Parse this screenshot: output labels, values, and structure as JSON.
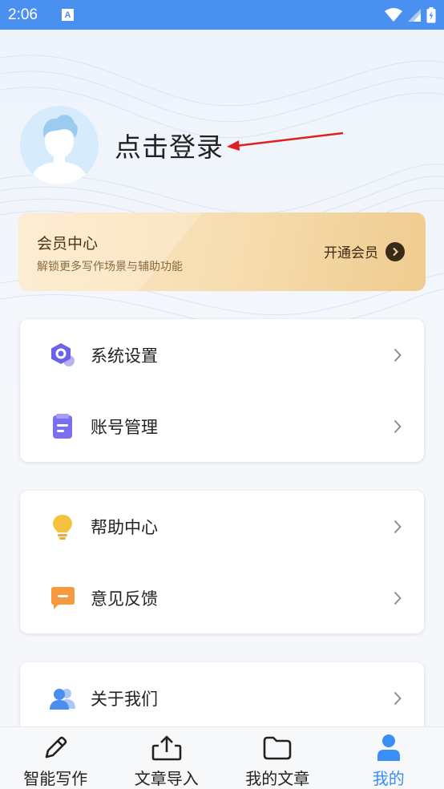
{
  "status_bar": {
    "time": "2:06",
    "notification_letter": "A"
  },
  "profile": {
    "login_label": "点击登录"
  },
  "vip": {
    "title": "会员中心",
    "subtitle": "解锁更多写作场景与辅助功能",
    "action_label": "开通会员"
  },
  "settings_group": {
    "items": [
      {
        "label": "系统设置",
        "icon": "settings-hexagon-icon"
      },
      {
        "label": "账号管理",
        "icon": "account-clipboard-icon"
      }
    ]
  },
  "help_group": {
    "items": [
      {
        "label": "帮助中心",
        "icon": "lightbulb-icon"
      },
      {
        "label": "意见反馈",
        "icon": "feedback-chat-icon"
      }
    ]
  },
  "about_group": {
    "items": [
      {
        "label": "关于我们",
        "icon": "users-icon"
      }
    ]
  },
  "tabbar": {
    "tabs": [
      {
        "label": "智能写作",
        "icon": "pencil-icon",
        "active": false
      },
      {
        "label": "文章导入",
        "icon": "upload-icon",
        "active": false
      },
      {
        "label": "我的文章",
        "icon": "folder-icon",
        "active": false
      },
      {
        "label": "我的",
        "icon": "person-icon",
        "active": true
      }
    ]
  },
  "colors": {
    "status_bar": "#4a90f0",
    "accent": "#3a8ef5",
    "annotation_arrow": "#e02020"
  }
}
